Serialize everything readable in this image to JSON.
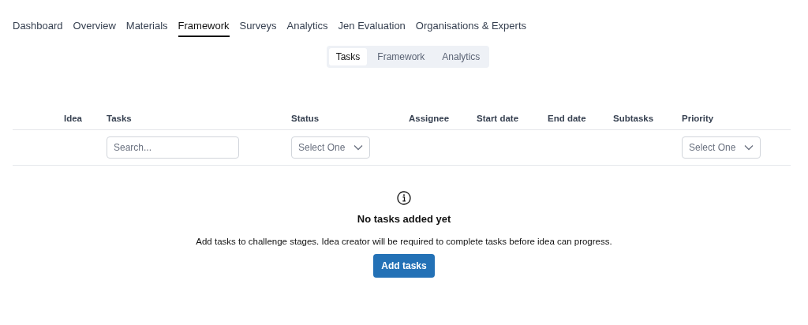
{
  "nav": [
    {
      "label": "Dashboard",
      "selected": false
    },
    {
      "label": "Overview",
      "selected": false
    },
    {
      "label": "Materials",
      "selected": false
    },
    {
      "label": "Framework",
      "selected": true
    },
    {
      "label": "Surveys",
      "selected": false
    },
    {
      "label": "Analytics",
      "selected": false
    },
    {
      "label": "Jen Evaluation",
      "selected": false
    },
    {
      "label": "Organisations & Experts",
      "selected": false
    }
  ],
  "subtabs": [
    {
      "label": "Tasks",
      "selected": true
    },
    {
      "label": "Framework",
      "selected": false
    },
    {
      "label": "Analytics",
      "selected": false
    }
  ],
  "table": {
    "columns": [
      "Idea",
      "Tasks",
      "Status",
      "Assignee",
      "Start date",
      "End date",
      "Subtasks",
      "Priority"
    ],
    "filters": {
      "tasks": {
        "placeholder": "Search..."
      },
      "status": {
        "value": "Select One"
      },
      "priority": {
        "value": "Select One"
      }
    }
  },
  "empty_state": {
    "title": "No tasks added yet",
    "message": "Add tasks to challenge stages. Idea creator will be required to complete tasks before idea can progress.",
    "button": "Add tasks"
  }
}
